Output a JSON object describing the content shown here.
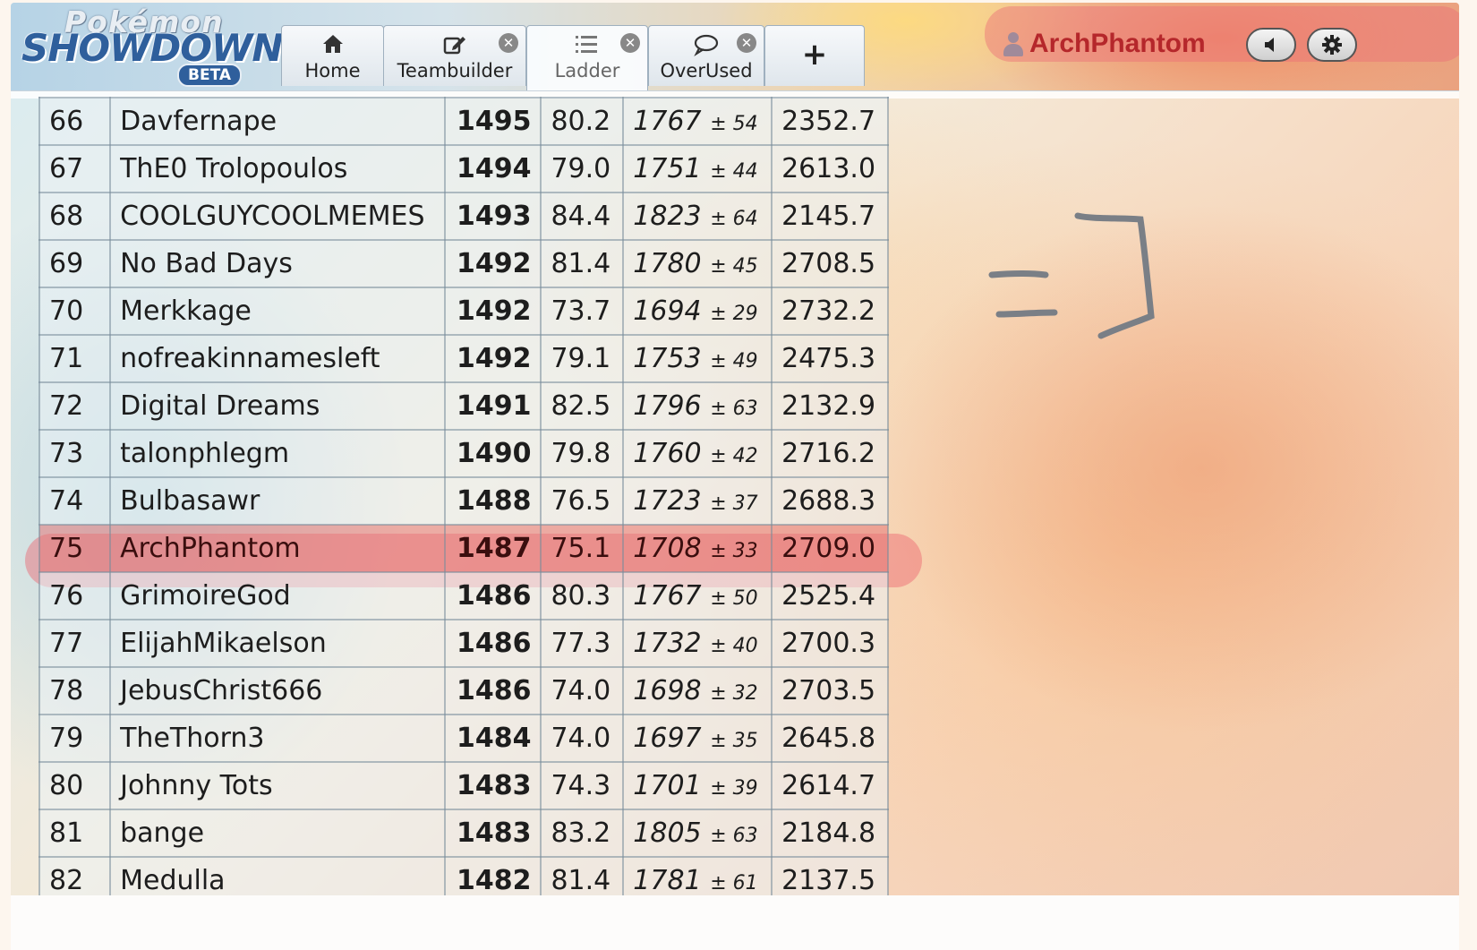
{
  "logo": {
    "top": "Pokémon",
    "main": "SHOWDOWN",
    "badge": "BETA"
  },
  "tabs": [
    {
      "label": "Home",
      "icon": "home-icon",
      "closable": false
    },
    {
      "label": "Teambuilder",
      "icon": "edit-icon",
      "closable": true
    },
    {
      "label": "Ladder",
      "icon": "list-icon",
      "closable": true,
      "active": true
    },
    {
      "label": "OverUsed",
      "icon": "chat-bubble-icon",
      "closable": true
    },
    {
      "label": "+",
      "icon": "plus-icon"
    }
  ],
  "user": {
    "name": "ArchPhantom",
    "sound_icon": "volume-icon",
    "settings_icon": "gear-icon"
  },
  "colors": {
    "username": "#b5272b",
    "highlight": "#ec6e78",
    "logo_blue": "#2f5f9c"
  },
  "ladder": {
    "rows": [
      {
        "rank": "66",
        "name": "Davfernape",
        "elo": "1495",
        "gxe": "80.2",
        "glicko": "1767",
        "dev": "± 54",
        "coil": "2352.7"
      },
      {
        "rank": "67",
        "name": "ThE0 Trolopoulos",
        "elo": "1494",
        "gxe": "79.0",
        "glicko": "1751",
        "dev": "± 44",
        "coil": "2613.0"
      },
      {
        "rank": "68",
        "name": "COOLGUYCOOLMEMES",
        "elo": "1493",
        "gxe": "84.4",
        "glicko": "1823",
        "dev": "± 64",
        "coil": "2145.7"
      },
      {
        "rank": "69",
        "name": "No Bad Days",
        "elo": "1492",
        "gxe": "81.4",
        "glicko": "1780",
        "dev": "± 45",
        "coil": "2708.5"
      },
      {
        "rank": "70",
        "name": "Merkkage",
        "elo": "1492",
        "gxe": "73.7",
        "glicko": "1694",
        "dev": "± 29",
        "coil": "2732.2"
      },
      {
        "rank": "71",
        "name": "nofreakinnamesleft",
        "elo": "1492",
        "gxe": "79.1",
        "glicko": "1753",
        "dev": "± 49",
        "coil": "2475.3"
      },
      {
        "rank": "72",
        "name": "Digital Dreams",
        "elo": "1491",
        "gxe": "82.5",
        "glicko": "1796",
        "dev": "± 63",
        "coil": "2132.9"
      },
      {
        "rank": "73",
        "name": "talonphlegm",
        "elo": "1490",
        "gxe": "79.8",
        "glicko": "1760",
        "dev": "± 42",
        "coil": "2716.2"
      },
      {
        "rank": "74",
        "name": "Bulbasawr",
        "elo": "1488",
        "gxe": "76.5",
        "glicko": "1723",
        "dev": "± 37",
        "coil": "2688.3"
      },
      {
        "rank": "75",
        "name": "ArchPhantom",
        "elo": "1487",
        "gxe": "75.1",
        "glicko": "1708",
        "dev": "± 33",
        "coil": "2709.0",
        "highlight": true
      },
      {
        "rank": "76",
        "name": "GrimoireGod",
        "elo": "1486",
        "gxe": "80.3",
        "glicko": "1767",
        "dev": "± 50",
        "coil": "2525.4"
      },
      {
        "rank": "77",
        "name": "ElijahMikaelson",
        "elo": "1486",
        "gxe": "77.3",
        "glicko": "1732",
        "dev": "± 40",
        "coil": "2700.3"
      },
      {
        "rank": "78",
        "name": "JebusChrist666",
        "elo": "1486",
        "gxe": "74.0",
        "glicko": "1698",
        "dev": "± 32",
        "coil": "2703.5"
      },
      {
        "rank": "79",
        "name": "TheThorn3",
        "elo": "1484",
        "gxe": "74.0",
        "glicko": "1697",
        "dev": "± 35",
        "coil": "2645.8"
      },
      {
        "rank": "80",
        "name": "Johnny Tots",
        "elo": "1483",
        "gxe": "74.3",
        "glicko": "1701",
        "dev": "± 39",
        "coil": "2614.7"
      },
      {
        "rank": "81",
        "name": "bange",
        "elo": "1483",
        "gxe": "83.2",
        "glicko": "1805",
        "dev": "± 63",
        "coil": "2184.8"
      },
      {
        "rank": "82",
        "name": "Medulla",
        "elo": "1482",
        "gxe": "81.4",
        "glicko": "1781",
        "dev": "± 61",
        "coil": "2137.5"
      }
    ]
  }
}
